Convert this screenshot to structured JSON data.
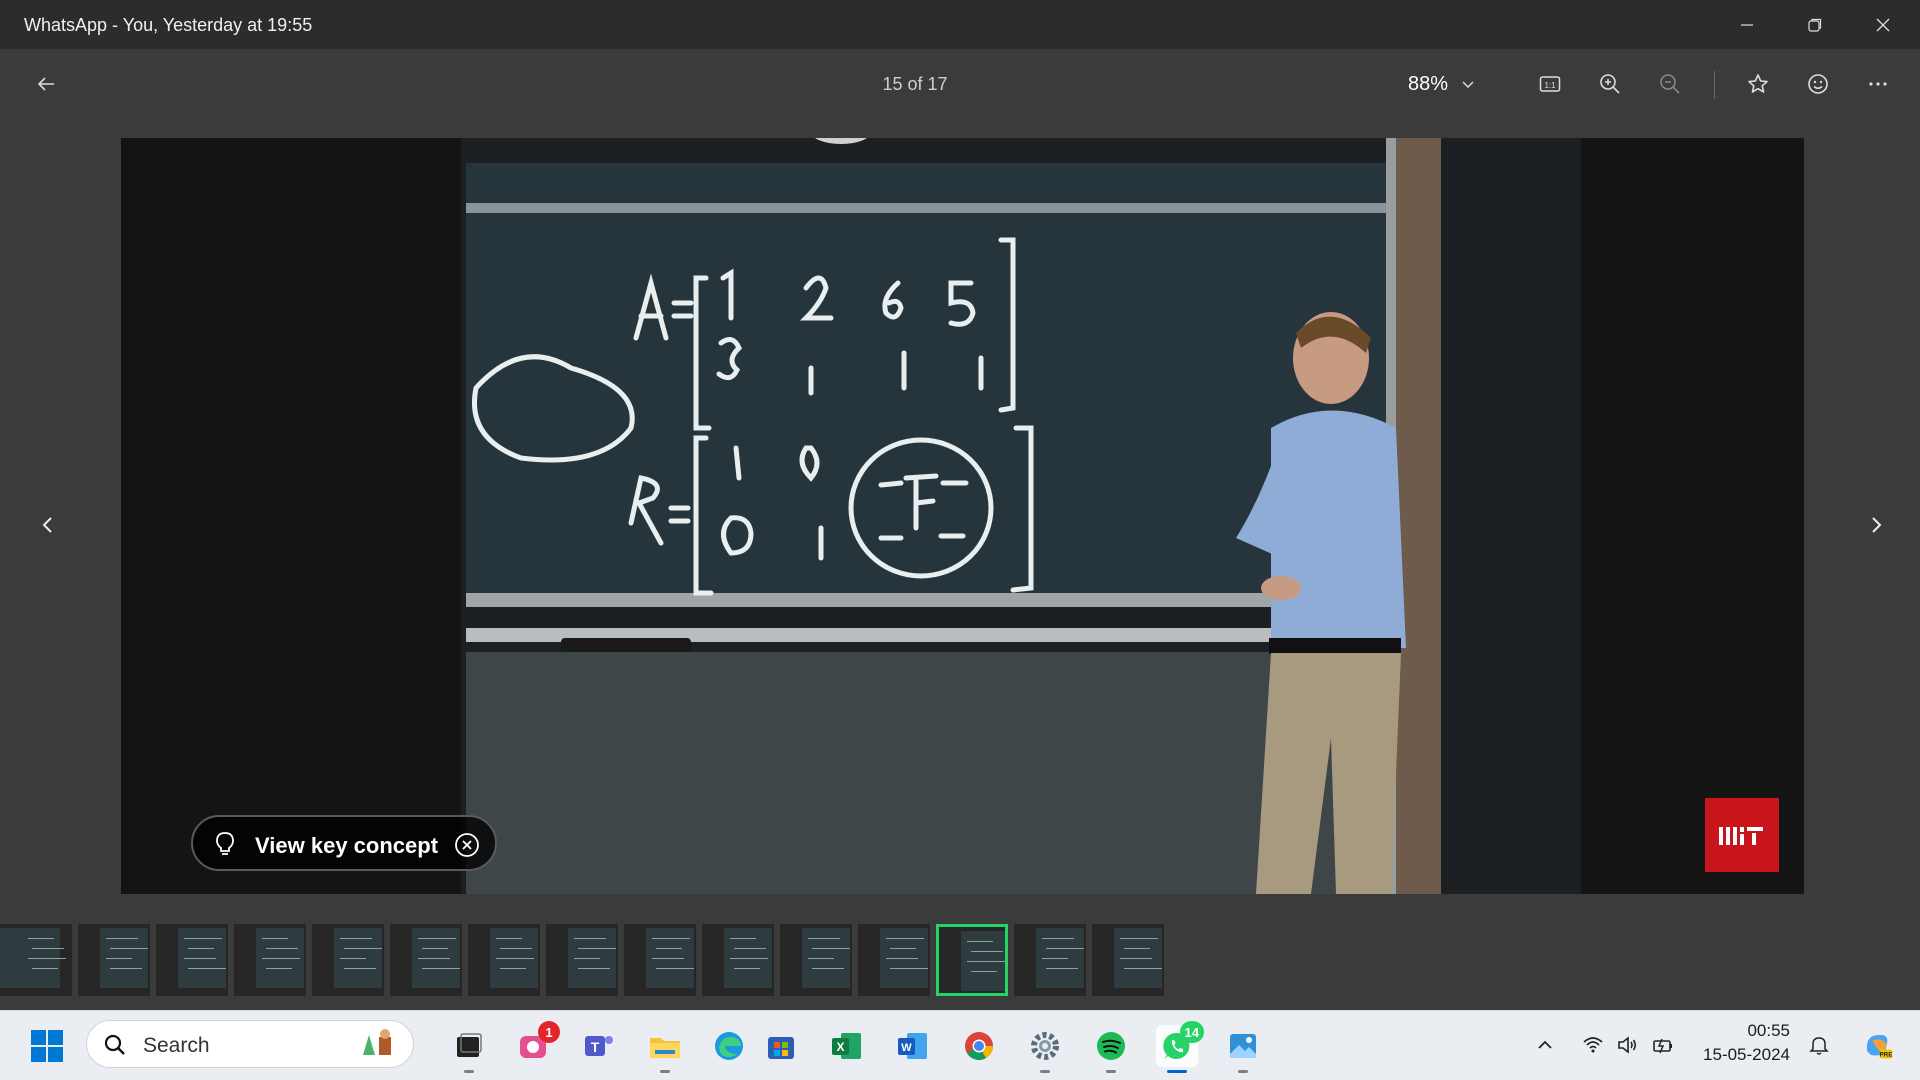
{
  "window": {
    "title": "WhatsApp - You, Yesterday at 19:55",
    "controls": [
      "minimize-icon",
      "restore-icon",
      "close-icon"
    ]
  },
  "toolbar": {
    "back_icon": "arrow-left-icon",
    "counter": "15 of 17",
    "zoom": "88%",
    "actions": [
      "actual-size-icon",
      "zoom-in-icon",
      "zoom-out-icon",
      "star-icon",
      "emoji-icon",
      "more-icon"
    ]
  },
  "viewer": {
    "key_concept_label": "View key concept",
    "logo_text": "MIT",
    "nav": [
      "chevron-left-icon",
      "chevron-right-icon"
    ]
  },
  "filmstrip": {
    "count": 15,
    "active_index": 12
  },
  "taskbar": {
    "search_placeholder": "Search",
    "apps": [
      {
        "name": "task-view",
        "icon": "task-view-icon"
      },
      {
        "name": "copilot-social",
        "icon": "social-app-icon",
        "badge": "1"
      },
      {
        "name": "teams",
        "icon": "teams-icon"
      },
      {
        "name": "file-explorer",
        "icon": "folder-icon"
      },
      {
        "name": "edge",
        "icon": "edge-icon"
      },
      {
        "name": "store",
        "icon": "store-icon"
      },
      {
        "name": "excel",
        "icon": "excel-icon"
      },
      {
        "name": "word",
        "icon": "word-icon"
      },
      {
        "name": "chrome",
        "icon": "chrome-icon"
      },
      {
        "name": "settings",
        "icon": "gear-icon"
      },
      {
        "name": "spotify",
        "icon": "spotify-icon"
      },
      {
        "name": "whatsapp",
        "icon": "whatsapp-icon",
        "badge": "14"
      },
      {
        "name": "photos",
        "icon": "photos-icon"
      }
    ],
    "clock_time": "00:55",
    "clock_date": "15-05-2024",
    "colors": {
      "whatsapp_badge": "#25d366",
      "notify_badge": "#e3242b"
    }
  }
}
